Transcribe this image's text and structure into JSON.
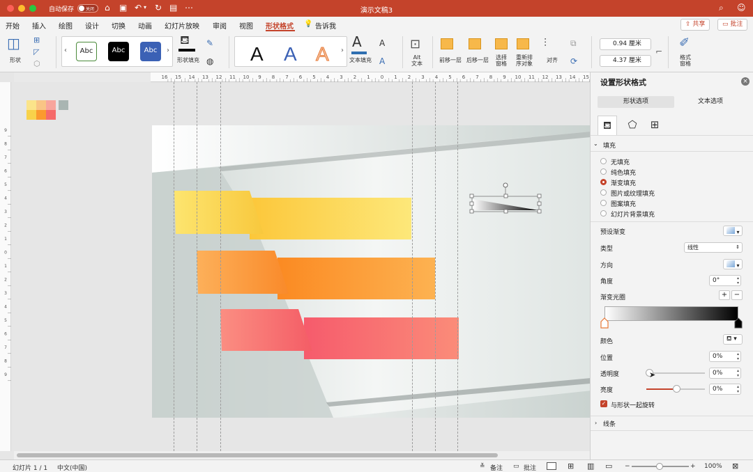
{
  "titlebar": {
    "autosave_label": "自动保存",
    "autosave_state": "关闭",
    "doc_title": "演示文稿3",
    "colors": {
      "bar": "#c4432b"
    }
  },
  "tabs": [
    "开始",
    "插入",
    "绘图",
    "设计",
    "切换",
    "动画",
    "幻灯片放映",
    "审阅",
    "视图",
    "形状格式",
    "告诉我"
  ],
  "active_tab": "形状格式",
  "top_buttons": {
    "share": "共享",
    "comment": "批注"
  },
  "ribbon": {
    "shapes_label": "形状",
    "style_chip_text": "Abc",
    "fill_label": "形状填充",
    "wordart_letter": "A",
    "text_fill_label": "文本填充",
    "alt_text_label": "Alt\n文本",
    "bring_forward": "前移一层",
    "send_backward": "后移一层",
    "selection_pane": "选择\n窗格",
    "reorder": "重新排\n序对象",
    "align": "对齐",
    "height_value": "0.94 厘米",
    "width_value": "4.37 厘米",
    "format_pane": "格式\n窗格"
  },
  "ruler_ticks": [
    "16",
    "15",
    "14",
    "13",
    "12",
    "11",
    "10",
    "9",
    "8",
    "7",
    "6",
    "5",
    "4",
    "3",
    "2",
    "1",
    "0",
    "1",
    "2",
    "3",
    "4",
    "5",
    "6",
    "7",
    "8",
    "9",
    "10",
    "11",
    "12",
    "13",
    "14",
    "15",
    "16"
  ],
  "vruler_ticks": [
    "9",
    "8",
    "7",
    "6",
    "5",
    "4",
    "3",
    "2",
    "1",
    "0",
    "1",
    "2",
    "3",
    "4",
    "5",
    "6",
    "7",
    "8",
    "9"
  ],
  "slide_colors": {
    "yellow": "#f8d24a",
    "orange": "#fb9a2e",
    "red": "#f66a6a"
  },
  "panel": {
    "title": "设置形状格式",
    "tab_shape": "形状选项",
    "tab_text": "文本选项",
    "fill_section": "填充",
    "fill_options": [
      "无填充",
      "纯色填充",
      "渐变填充",
      "图片或纹理填充",
      "图案填充",
      "幻灯片背景填充"
    ],
    "fill_selected": "渐变填充",
    "preset_gradient": "预设渐变",
    "type_label": "类型",
    "type_value": "线性",
    "direction_label": "方向",
    "angle_label": "角度",
    "angle_value": "0°",
    "gradient_stops": "渐变光圈",
    "color_label": "颜色",
    "position_label": "位置",
    "position_value": "0%",
    "transparency_label": "透明度",
    "transparency_value": "0%",
    "brightness_label": "亮度",
    "brightness_value": "0%",
    "rotate_with_shape": "与形状一起旋转",
    "line_section": "线条"
  },
  "statusbar": {
    "slide_info": "幻灯片 1 / 1",
    "language": "中文(中国)",
    "notes": "备注",
    "comments": "批注",
    "zoom": "100%"
  }
}
